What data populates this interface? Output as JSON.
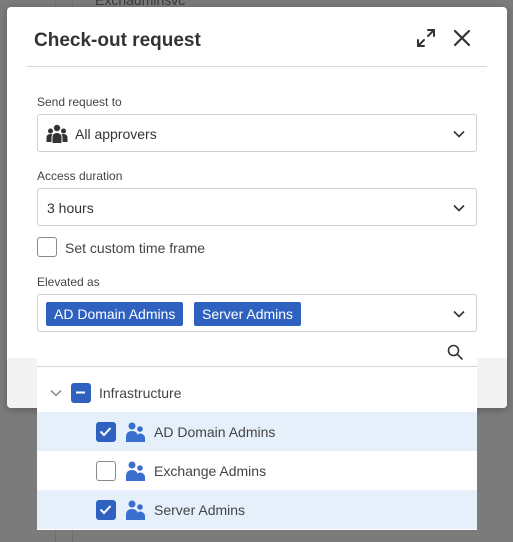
{
  "background": {
    "partial_text": "Exchadminsvc"
  },
  "modal": {
    "title": "Check-out request",
    "expand_icon": "expand-icon",
    "close_icon": "close-icon"
  },
  "send_request": {
    "label": "Send request to",
    "value": "All approvers",
    "icon": "users-group-icon"
  },
  "access_duration": {
    "label": "Access duration",
    "value": "3 hours"
  },
  "custom_time": {
    "label": "Set custom time frame",
    "checked": false
  },
  "elevated_as": {
    "label": "Elevated as",
    "tags": [
      "AD Domain Admins",
      "Server Admins"
    ]
  },
  "dropdown": {
    "search_placeholder": "",
    "group": {
      "label": "Infrastructure",
      "state": "indeterminate"
    },
    "items": [
      {
        "label": "AD Domain Admins",
        "checked": true
      },
      {
        "label": "Exchange Admins",
        "checked": false
      },
      {
        "label": "Server Admins",
        "checked": true
      }
    ]
  },
  "colors": {
    "accent": "#2f62c0",
    "selected_row": "#e6f0fb",
    "icon_blue": "#3a6fd0"
  }
}
